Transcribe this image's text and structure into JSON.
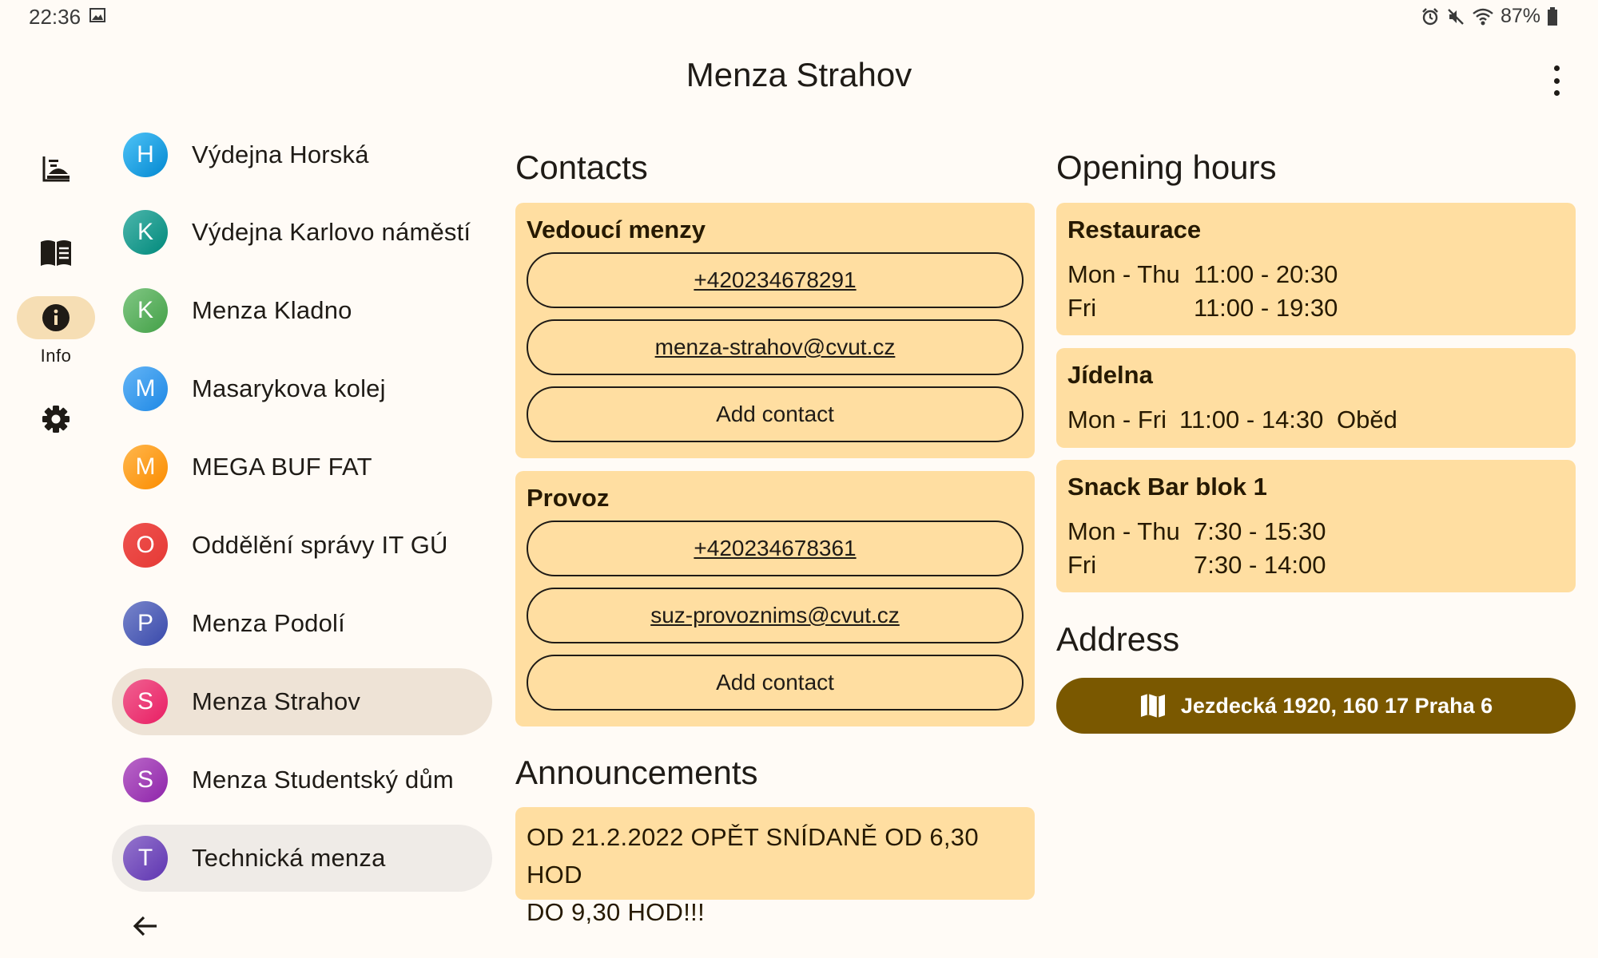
{
  "status_bar": {
    "time": "22:36",
    "battery": "87%"
  },
  "app_bar": {
    "title": "Menza Strahov"
  },
  "nav_rail": {
    "items": [
      {
        "name": "dish-icon",
        "label": ""
      },
      {
        "name": "menu-book-icon",
        "label": ""
      },
      {
        "name": "info-icon",
        "label": "Info",
        "active": true
      },
      {
        "name": "gear-icon",
        "label": ""
      }
    ]
  },
  "canteens": [
    {
      "letter": "H",
      "name": "Výdejna Horská",
      "color": "#29B6F6"
    },
    {
      "letter": "K",
      "name": "Výdejna Karlovo náměstí",
      "color": "#26A69A"
    },
    {
      "letter": "K",
      "name": "Menza Kladno",
      "color": "#66BB6A"
    },
    {
      "letter": "M",
      "name": "Masarykova kolej",
      "color": "#42A5F5"
    },
    {
      "letter": "M",
      "name": "MEGA BUF FAT",
      "color": "#FFA726"
    },
    {
      "letter": "O",
      "name": "Oddělění správy IT GÚ",
      "color": "#EF5350"
    },
    {
      "letter": "P",
      "name": "Menza Podolí",
      "color": "#5C6BC0"
    },
    {
      "letter": "S",
      "name": "Menza Strahov",
      "color": "#EC407A",
      "selected": true
    },
    {
      "letter": "S",
      "name": "Menza Studentský dům",
      "color": "#AB47BC"
    },
    {
      "letter": "T",
      "name": "Technická menza",
      "color": "#7E57C2"
    }
  ],
  "contacts": {
    "heading": "Contacts",
    "groups": [
      {
        "title": "Vedoucí menzy",
        "phone": "+420234678291",
        "email": "menza-strahov@cvut.cz",
        "add_label": "Add contact"
      },
      {
        "title": "Provoz",
        "phone": "+420234678361",
        "email": "suz-provoznims@cvut.cz",
        "add_label": "Add contact"
      }
    ]
  },
  "announcements": {
    "heading": "Announcements",
    "lines": [
      "OD 21.2.2022 OPĚT SNÍDANĚ OD 6,30 HOD",
      "DO 9,30 HOD!!!"
    ]
  },
  "opening_hours": {
    "heading": "Opening hours",
    "places": [
      {
        "title": "Restaurace",
        "rows": [
          {
            "days": "Mon - Thu",
            "time": "11:00 - 20:30",
            "note": ""
          },
          {
            "days": "Fri",
            "time": "11:00 - 19:30",
            "note": ""
          }
        ]
      },
      {
        "title": "Jídelna",
        "rows": [
          {
            "days": "Mon - Fri",
            "time": "11:00 - 14:30",
            "note": "Oběd"
          }
        ]
      },
      {
        "title": "Snack Bar blok 1",
        "rows": [
          {
            "days": "Mon - Thu",
            "time": "7:30 - 15:30",
            "note": ""
          },
          {
            "days": "Fri",
            "time": "7:30 - 14:00",
            "note": ""
          }
        ]
      }
    ]
  },
  "address": {
    "heading": "Address",
    "text": "Jezdecká 1920, 160 17 Praha 6",
    "icon": "map-icon"
  },
  "colors": {
    "background": "#FFFBF6",
    "card": "#FFDEA1",
    "primary": "#7A5800",
    "selected_item": "#EEE3D6"
  }
}
